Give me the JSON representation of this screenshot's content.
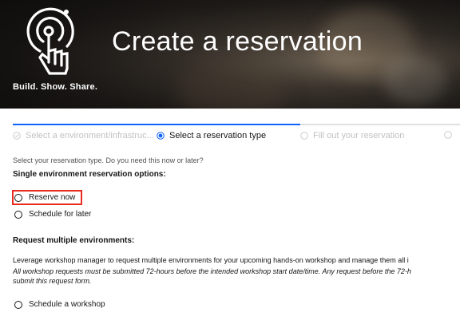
{
  "hero": {
    "title": "Create a reservation",
    "tagline": "Build. Show. Share."
  },
  "progress": {
    "steps": [
      {
        "label": "Select a environment/infrastruc...",
        "state": "complete"
      },
      {
        "label": "Select a reservation type",
        "state": "current"
      },
      {
        "label": "Fill out your reservation",
        "state": "incomplete"
      }
    ]
  },
  "form": {
    "intro": "Select your reservation type. Do you need this now or later?",
    "single_heading": "Single environment reservation options:",
    "options": {
      "reserve_now": "Reserve now",
      "schedule_later": "Schedule for later"
    },
    "multi_heading": "Request multiple environments:",
    "multi_text": "Leverage workshop manager to request multiple environments for your upcoming hands-on workshop and manage them all i",
    "multi_italic_line1": "All workshop requests must be submitted 72-hours before the intended workshop start date/time. Any request before the 72-h",
    "multi_italic_line2": "submit this request form.",
    "schedule_workshop": "Schedule a workshop"
  },
  "colors": {
    "accent": "#0f62fe",
    "highlight": "#e82b1e"
  }
}
